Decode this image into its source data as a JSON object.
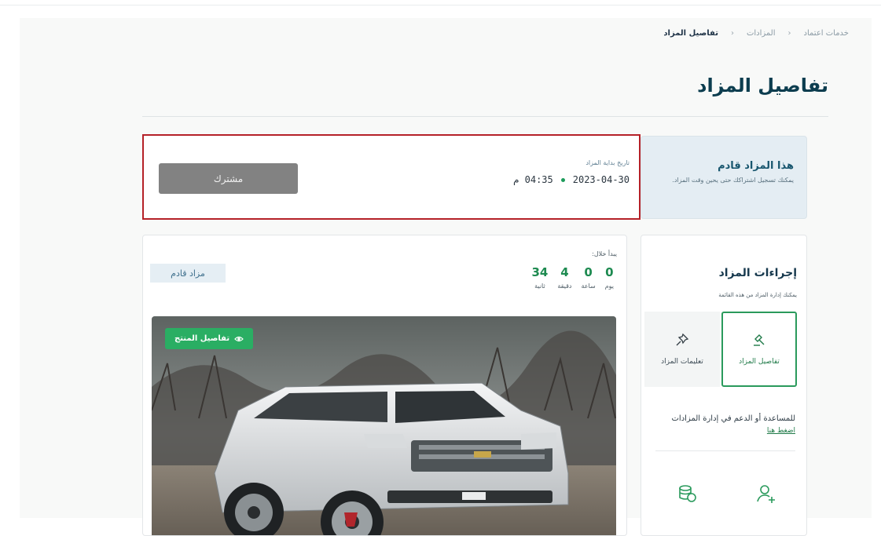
{
  "breadcrumb": {
    "items": [
      "خدمات اعتماد",
      "المزادات",
      "تفاصيل المزاد"
    ],
    "separator": "‹"
  },
  "page_title": "تفاصيل المزاد",
  "status_card": {
    "title": "هذا المزاد قادم",
    "subtitle": "يمكنك تسجيل اشتراكك حتى يحين وقت المزاد."
  },
  "auction_start": {
    "label": "تاريخ بداية المزاد",
    "date": "2023-04-30",
    "time": "04:35 م"
  },
  "subscribe_button": "مشترك",
  "countdown": {
    "label": "يبدأ خلال:",
    "units": [
      {
        "value": "0",
        "label": "يوم"
      },
      {
        "value": "0",
        "label": "ساعة"
      },
      {
        "value": "4",
        "label": "دقيقة"
      },
      {
        "value": "34",
        "label": "ثانية"
      }
    ]
  },
  "status_badge": "مزاد قادم",
  "product_details_button": "تفاصيل المنتج",
  "actions_panel": {
    "title": "إجراءات المزاد",
    "subtitle": "يمكنك إدارة المزاد من هذه القائمة",
    "tiles": [
      {
        "label": "تفاصيل المزاد",
        "icon": "gavel-icon"
      },
      {
        "label": "تعليمات المزاد",
        "icon": "pin-icon"
      }
    ],
    "help_text": "للمساعدة أو الدعم في إدارة المزادات",
    "help_link": "اضغط هنا",
    "bottom_icons": [
      "add-user-icon",
      "coins-icon"
    ]
  },
  "colors": {
    "accent_green": "#2aae63",
    "title_blue": "#0c3d4f",
    "highlight_red": "#b52128",
    "info_bg": "#e4edf3"
  }
}
